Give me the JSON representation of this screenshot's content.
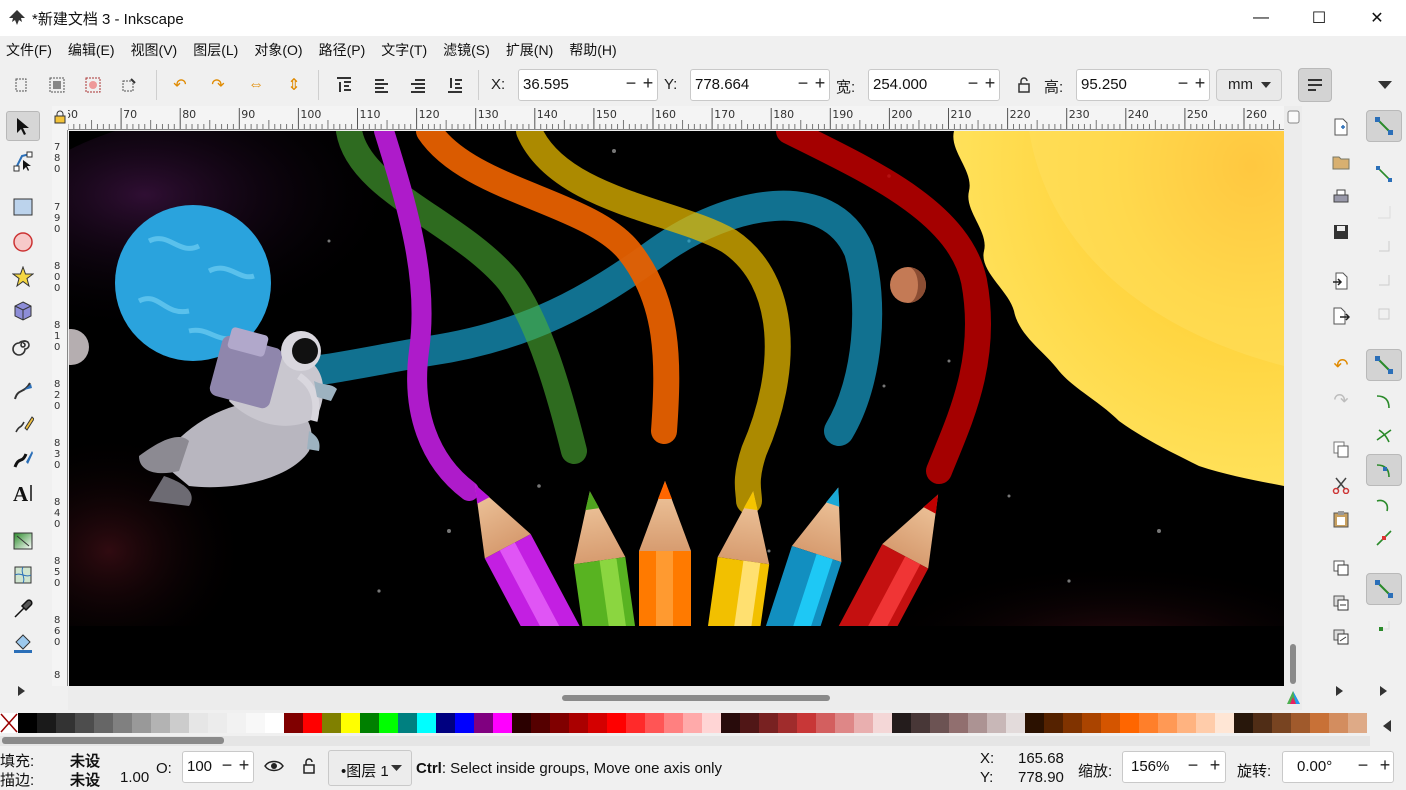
{
  "window": {
    "title": "*新建文档 3 - Inkscape",
    "minimize": "—",
    "maximize": "☐",
    "close": "✕"
  },
  "menu": [
    "文件(F)",
    "编辑(E)",
    "视图(V)",
    "图层(L)",
    "对象(O)",
    "路径(P)",
    "文字(T)",
    "滤镜(S)",
    "扩展(N)",
    "帮助(H)"
  ],
  "toolbar": {
    "x_label": "X:",
    "x_value": "36.595",
    "y_label": "Y:",
    "y_value": "778.664",
    "w_label": "宽:",
    "w_value": "254.000",
    "h_label": "高:",
    "h_value": "95.250",
    "unit": "mm",
    "minus": "−",
    "plus": "+"
  },
  "ruler": {
    "h_labels": [
      "60",
      "70",
      "80",
      "90",
      "100",
      "110",
      "120",
      "130",
      "140",
      "150",
      "160",
      "170",
      "180",
      "190",
      "200",
      "210",
      "220",
      "230",
      "240",
      "250",
      "260"
    ]
  },
  "palette": {
    "swatches": [
      "#000000",
      "#1a1a1a",
      "#333333",
      "#4d4d4d",
      "#666666",
      "#808080",
      "#999999",
      "#b3b3b3",
      "#cccccc",
      "#e6e6e6",
      "#ececec",
      "#f2f2f2",
      "#f8f8f8",
      "#ffffff",
      "#800000",
      "#ff0000",
      "#808000",
      "#ffff00",
      "#008000",
      "#00ff00",
      "#008080",
      "#00ffff",
      "#000080",
      "#0000ff",
      "#800080",
      "#ff00ff",
      "#2b0000",
      "#550000",
      "#800000",
      "#aa0000",
      "#d40000",
      "#ff0000",
      "#ff2a2a",
      "#ff5555",
      "#ff8080",
      "#ffaaaa",
      "#ffd5d5",
      "#280b0b",
      "#501616",
      "#782121",
      "#a02c2c",
      "#c83737",
      "#d35f5f",
      "#de8787",
      "#e9afaf",
      "#f4d7d7",
      "#241c1c",
      "#483737",
      "#6c5353",
      "#916f6f",
      "#ac9393",
      "#c8b7b7",
      "#e3dbdb",
      "#2b1100",
      "#552200",
      "#803300",
      "#aa4400",
      "#d45500",
      "#ff6600",
      "#ff7f2a",
      "#ff9955",
      "#ffb380",
      "#ffccaa",
      "#ffe6d5",
      "#28170b",
      "#502d16",
      "#784421",
      "#a05a2c",
      "#c87137",
      "#d38d5f",
      "#deaa87"
    ]
  },
  "status": {
    "fill_label": "填充:",
    "fill_value": "未设",
    "stroke_label": "描边:",
    "stroke_value": "未设",
    "stroke_width": "1.00",
    "opacity_label": "O:",
    "opacity_value": "100",
    "layer": "•图层 1",
    "message_key": "Ctrl",
    "message": ": Select inside groups, Move one axis only",
    "cursor_x_label": "X:",
    "cursor_x": "165.68",
    "cursor_y_label": "Y:",
    "cursor_y": "778.90",
    "zoom_label": "缩放:",
    "zoom_value": "156%",
    "rotate_label": "旋转:",
    "rotate_value": "0.00°"
  }
}
